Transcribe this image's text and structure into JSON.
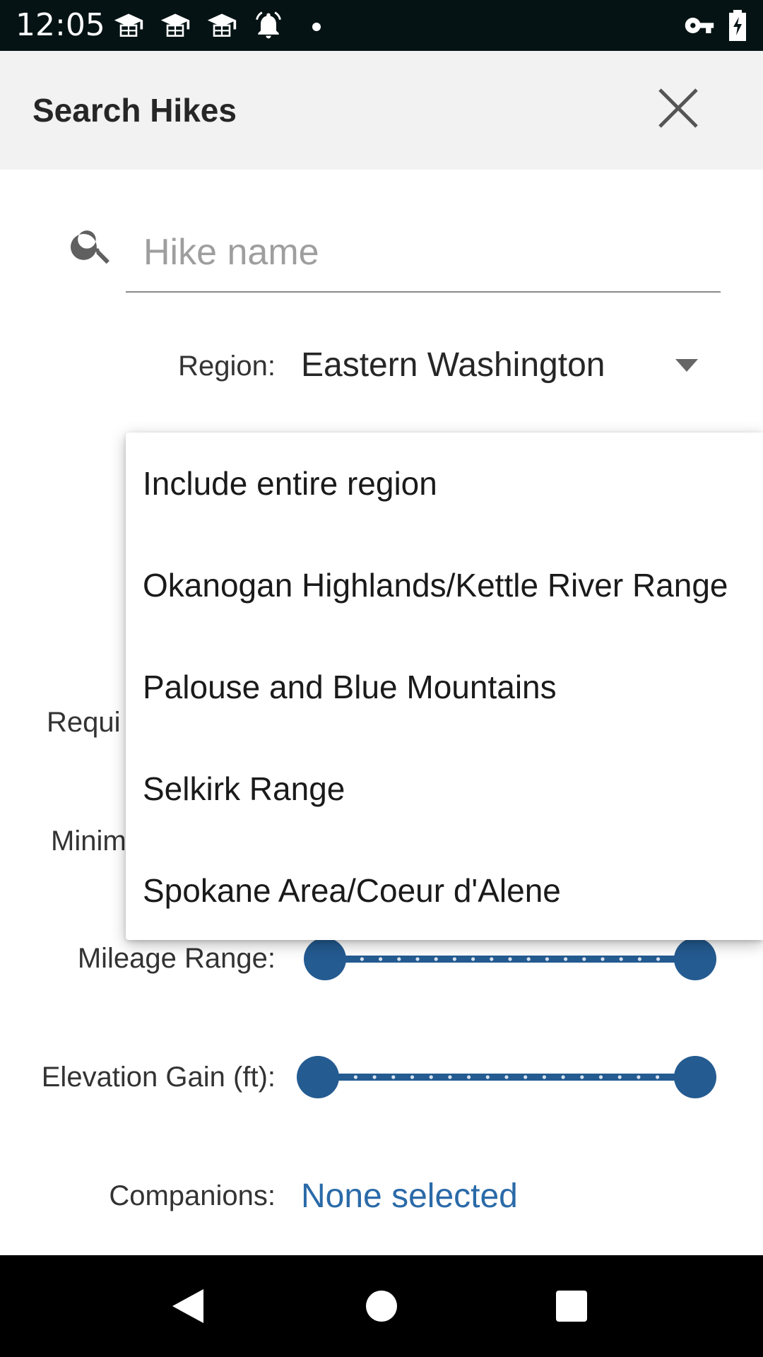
{
  "status_bar": {
    "time": "12:05",
    "icons": [
      "graduation-cap-icon",
      "graduation-cap-icon",
      "graduation-cap-icon",
      "alarm-icon",
      "dot-icon",
      "vpn-key-icon",
      "battery-charging-icon"
    ]
  },
  "app_bar": {
    "title": "Search Hikes",
    "close_icon": "close-icon"
  },
  "search": {
    "placeholder": "Hike name",
    "value": ""
  },
  "form": {
    "region_label": "Region:",
    "region_value": "Eastern Washington",
    "required_label_partial": "Requi",
    "minimum_label_partial": "Minim",
    "mileage_label": "Mileage Range:",
    "mileage_range": {
      "min_fraction": 0.0,
      "max_fraction": 1.0
    },
    "elevation_label": "Elevation Gain (ft):",
    "elevation_range": {
      "min_fraction": 0.0,
      "max_fraction": 1.0
    },
    "companions_label": "Companions:",
    "companions_value": "None selected"
  },
  "dropdown": {
    "options": [
      "Include entire region",
      "Okanogan Highlands/Kettle River Range",
      "Palouse and Blue Mountains",
      "Selkirk Range",
      "Spokane Area/Coeur d'Alene"
    ]
  },
  "nav_bar": {
    "buttons": [
      "back-icon",
      "home-icon",
      "recents-icon"
    ]
  },
  "colors": {
    "accent": "#245b91",
    "link": "#2a6aa8",
    "status_bar": "#051314",
    "app_bar": "#f2f2f2"
  }
}
